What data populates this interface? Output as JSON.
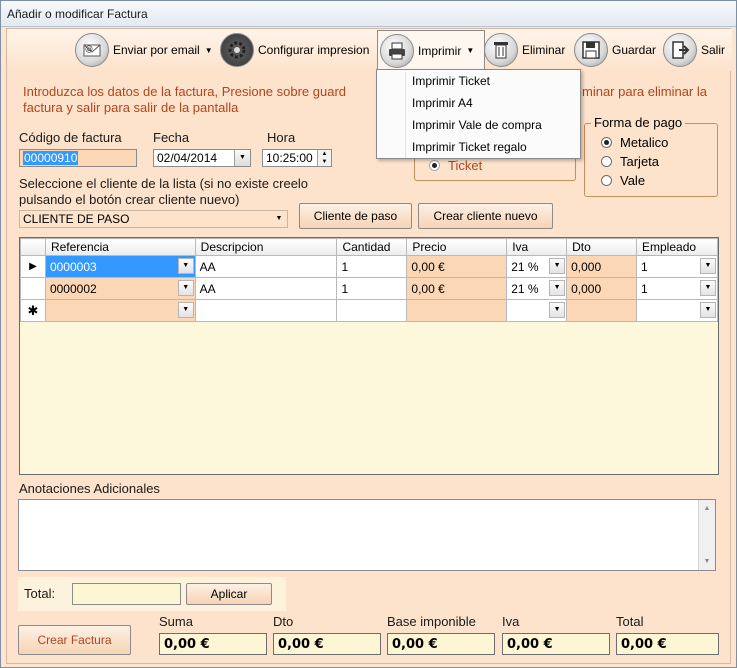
{
  "window": {
    "title": "Añadir o modificar Factura"
  },
  "toolbar": {
    "email": "Enviar por email",
    "config": "Configurar impresion",
    "print": "Imprimir",
    "delete": "Eliminar",
    "save": "Guardar",
    "exit": "Salir"
  },
  "print_menu": {
    "items": [
      "Imprimir Ticket",
      "Imprimir A4",
      "Imprimir Vale de compra",
      "Imprimir Ticket regalo"
    ]
  },
  "intro": {
    "line1_left": "Introduzca los datos de la factura, Presione sobre guard",
    "line1_right": "minar para eliminar la",
    "line2": "factura y salir para salir de la pantalla"
  },
  "form": {
    "codigo_label": "Código de factura",
    "codigo_value": "00000910",
    "fecha_label": "Fecha",
    "fecha_value": "02/04/2014",
    "hora_label": "Hora",
    "hora_value": "10:25:00",
    "cliente_hint_1": "Seleccione el cliente de la lista (si no existe creelo",
    "cliente_hint_2": "pulsando el botón crear cliente nuevo)",
    "cliente_value": "CLIENTE DE PASO",
    "btn_cliente_paso": "Cliente de paso",
    "btn_crear_cliente": "Crear cliente nuevo"
  },
  "tipo": {
    "option_ticket": "Ticket"
  },
  "forma_pago": {
    "legend": "Forma de pago",
    "options": [
      "Metalico",
      "Tarjeta",
      "Vale"
    ],
    "selected": "Metalico"
  },
  "grid": {
    "columns": [
      "Referencia",
      "Descripcion",
      "Cantidad",
      "Precio",
      "Iva",
      "Dto",
      "Empleado"
    ],
    "rows": [
      {
        "referencia": "0000003",
        "descripcion": "AA",
        "cantidad": "1",
        "precio": "0,00 €",
        "iva": "21 %",
        "dto": "0,000",
        "empleado": "1"
      },
      {
        "referencia": "0000002",
        "descripcion": "AA",
        "cantidad": "1",
        "precio": "0,00 €",
        "iva": "21 %",
        "dto": "0,000",
        "empleado": "1"
      }
    ]
  },
  "notes": {
    "label": "Anotaciones Adicionales"
  },
  "total": {
    "label": "Total:",
    "value": "",
    "apply": "Aplicar"
  },
  "summary": {
    "crear": "Crear Factura",
    "suma_label": "Suma",
    "suma": "0,00 €",
    "dto_label": "Dto",
    "dto": "0,00 €",
    "base_label": "Base imponible",
    "base": "0,00 €",
    "iva_label": "Iva",
    "iva": "0,00 €",
    "total_label": "Total",
    "total": "0,00 €"
  }
}
